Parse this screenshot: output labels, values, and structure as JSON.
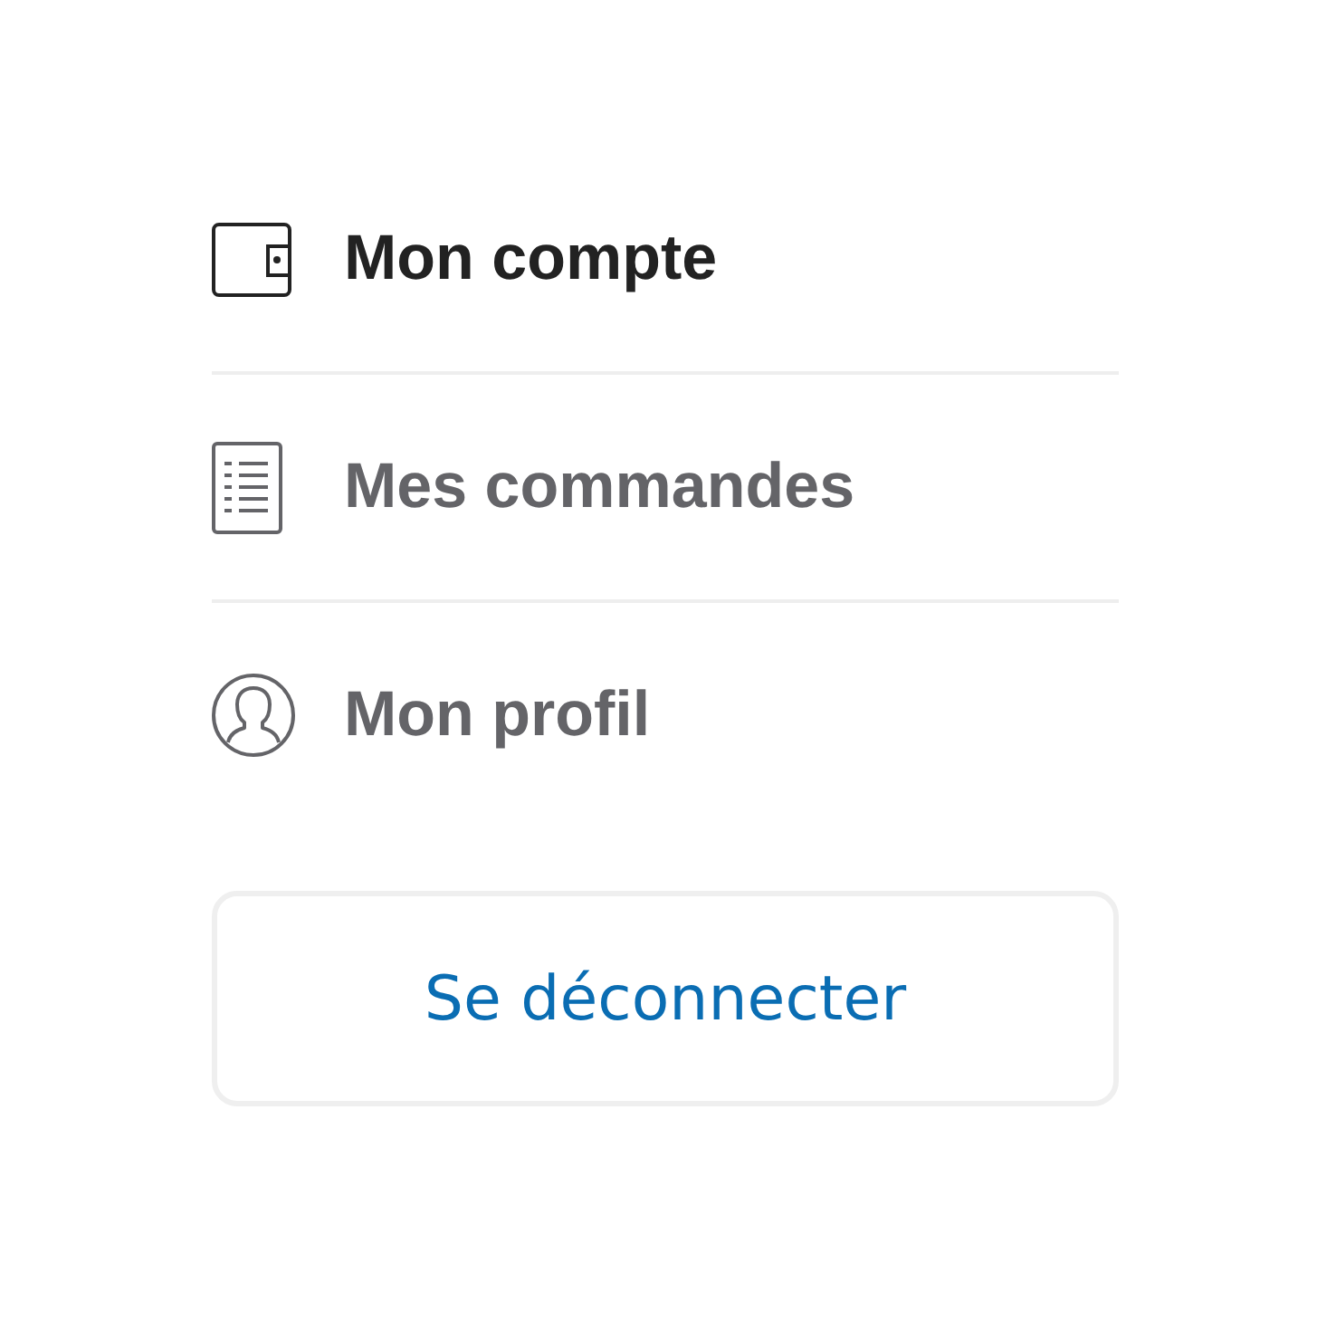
{
  "menu": {
    "items": [
      {
        "kind": "wallet",
        "label": "Mon compte",
        "selected": true
      },
      {
        "kind": "list",
        "label": "Mes commandes",
        "selected": false
      },
      {
        "kind": "profile",
        "label": "Mon profil",
        "selected": false
      }
    ]
  },
  "logout_button": {
    "label": "Se déconnecter"
  }
}
